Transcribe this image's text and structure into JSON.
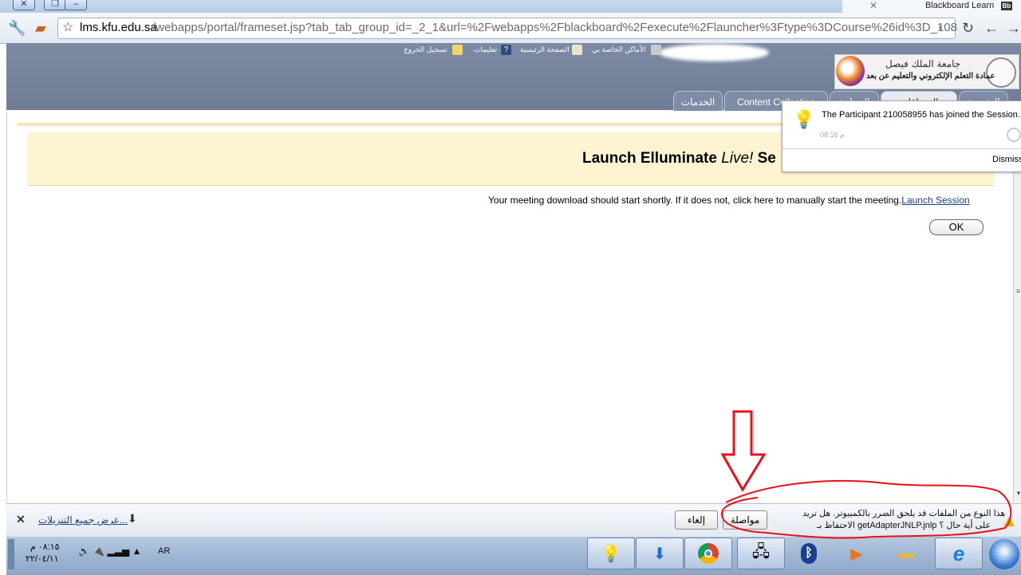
{
  "browser": {
    "tab_title": "Blackboard Learn",
    "tab_favicon": "Bb",
    "url_domain": "lms.kfu.edu.sa",
    "url_path": "/webapps/portal/frameset.jsp?tab_tab_group_id=_2_1&url=%2Fwebapps%2Fblackboard%2Fexecute%2Flauncher%3Ftype%3DCourse%26id%3D_108"
  },
  "portal": {
    "toplinks": {
      "logout": "تسجيل الخروج",
      "help": "تعليمات",
      "home": "الصفحة الرئيسية",
      "my_places": "الأماكن الخاصة بي"
    },
    "logo_line1": "جامعة الملك فيصل",
    "logo_line2": "عمادة التعلم الإلكتروني والتعليم عن بعد",
    "tabs": [
      "الخدمات",
      "Content Collection",
      "الجماعة",
      "المساقات الدراسية",
      "الرئيسية"
    ]
  },
  "content": {
    "banner_title_prefix": "Launch Elluminate ",
    "banner_title_live": "Live!",
    "banner_title_suffix": " Se",
    "message": "Your meeting download should start shortly. If it does not, click here to manually start the meeting.",
    "launch_link": "Launch Session",
    "ok_label": "OK"
  },
  "notification": {
    "text": "The Participant 210058955 has joined the Session.",
    "time": "08:16 م",
    "dismiss": "Dismiss"
  },
  "download_bar": {
    "show_all": "عرض جميع التنزيلات...",
    "cancel_label": "إلغاء",
    "continue_label": "مواصلة",
    "warning_line1": "هذا النوع من الملفات قد يلحق الضرر بالكمبيوتر. هل تريد",
    "warning_line2": "الاحتفاظ بـ getAdapterJNLP.jnlp على أية حال ؟"
  },
  "taskbar": {
    "clock_time": "٠٨:١٥ م",
    "clock_date": "٢٢/٠٤/١١",
    "language": "AR",
    "apps": [
      "elluminate-icon",
      "download-icon",
      "chrome-icon",
      "network-icon",
      "bluetooth-icon",
      "media-player-icon",
      "file-explorer-icon",
      "internet-explorer-icon",
      "start-orb-icon"
    ]
  },
  "colors": {
    "portal_header": "#7c8aa4",
    "banner_bg": "#fff4d2",
    "link": "#1e3f8a",
    "annotation": "#e8101a",
    "taskbar": "#9fb6d3"
  }
}
